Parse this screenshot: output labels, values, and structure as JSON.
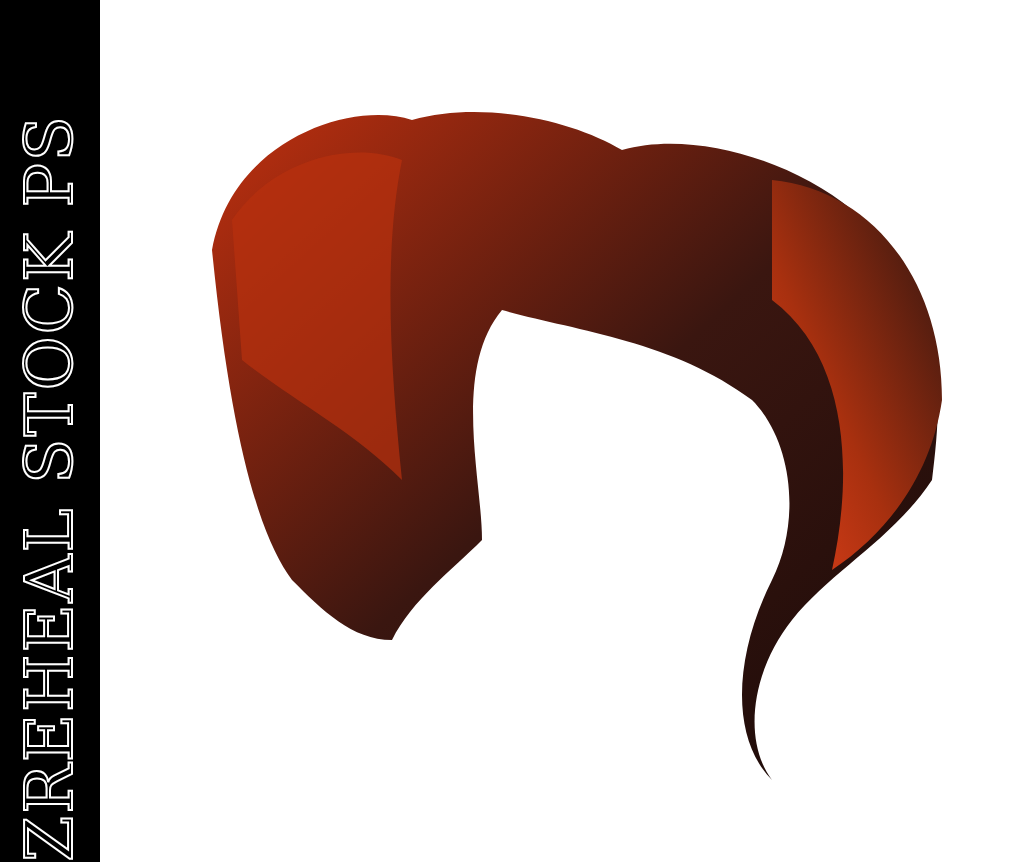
{
  "banner": {
    "text": "ZREHEAL STOCK PS"
  },
  "photo": {
    "kind": "hair-cutout"
  }
}
